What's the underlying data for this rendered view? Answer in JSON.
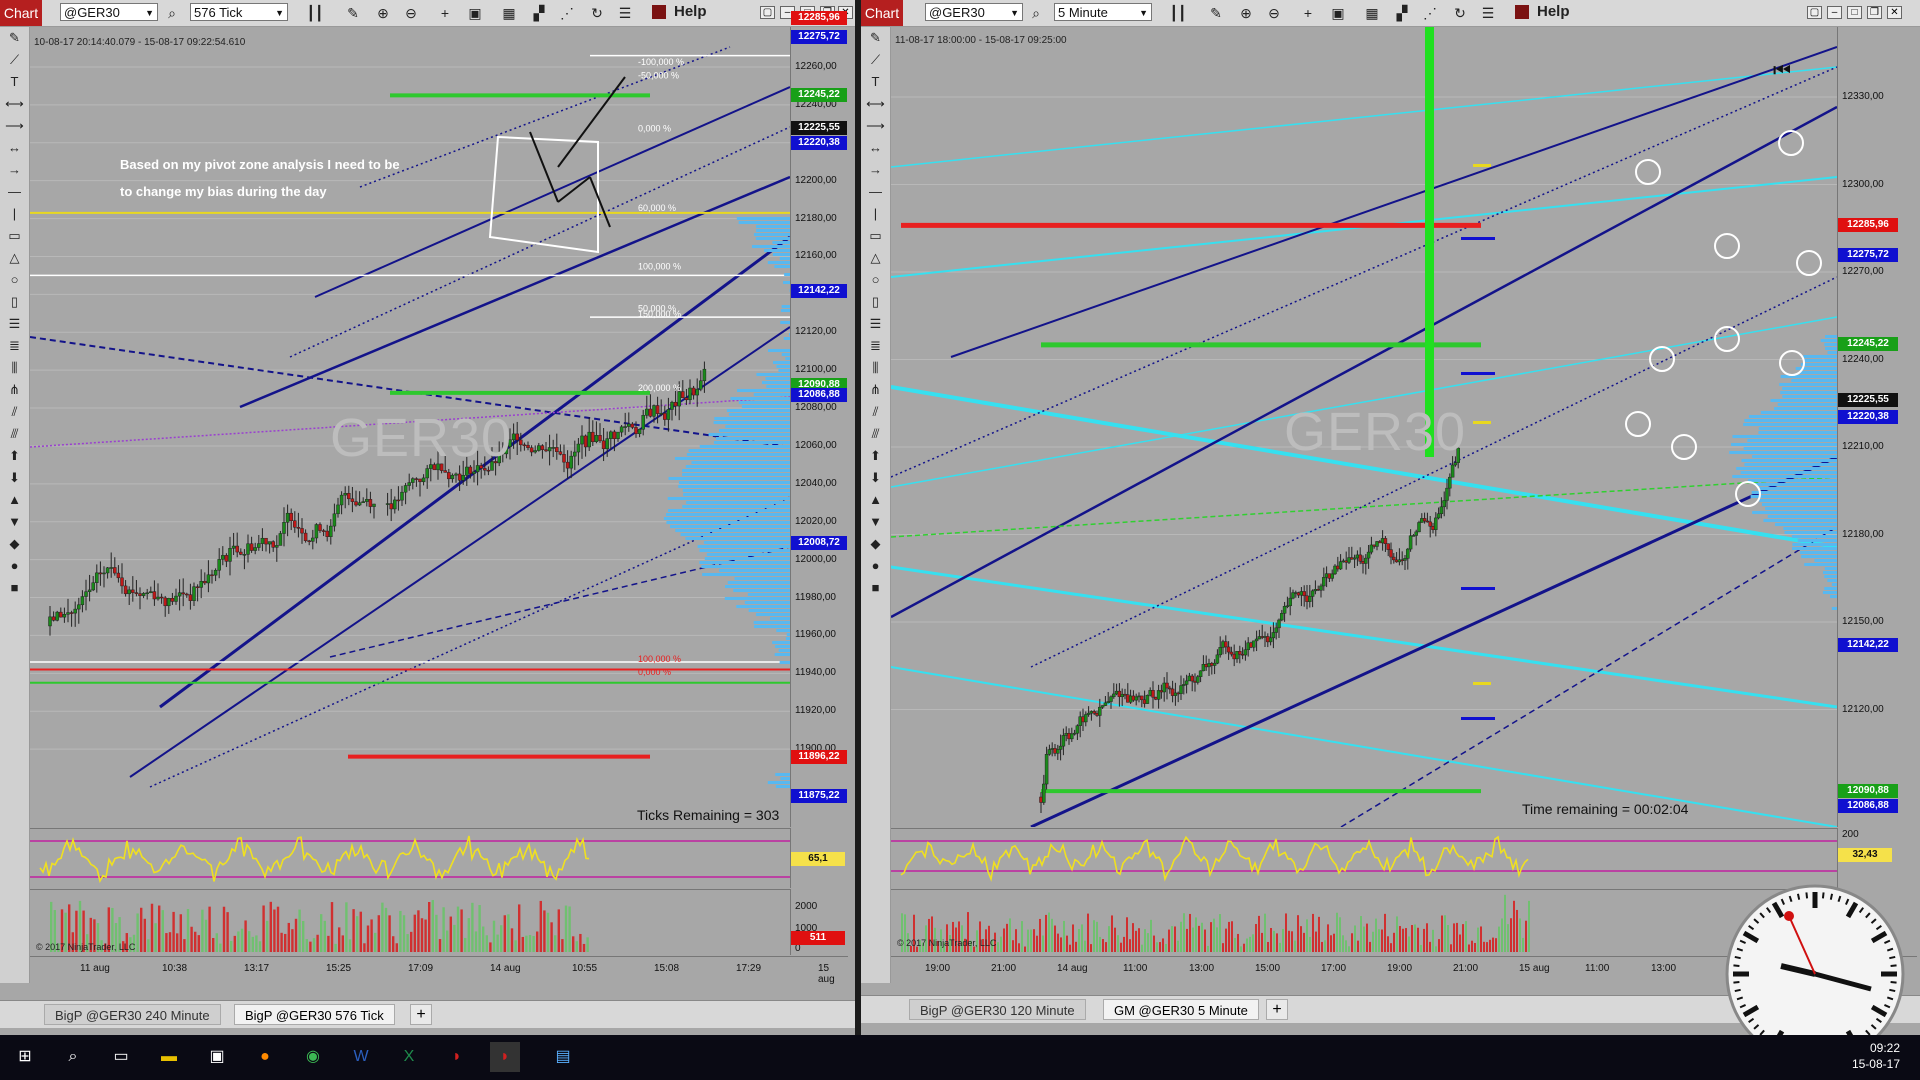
{
  "left": {
    "chart_label": "Chart",
    "instrument": "@GER30",
    "interval": "576 Tick",
    "help": "Help",
    "date_range": "10-08-17 20:14:40.079 - 15-08-17 09:22:54.610",
    "watermark": "GER30",
    "annotation_line1": "Based on my pivot zone analysis I need to be",
    "annotation_line2": "to change my bias during the day",
    "ticks_remaining": "Ticks Remaining = 303",
    "copyright": "© 2017 NinjaTrader, LLC",
    "price_ticks": [
      "12260,00",
      "12240,00",
      "12220,00",
      "12200,00",
      "12180,00",
      "12160,00",
      "12140,00",
      "12120,00",
      "12100,00",
      "12080,00",
      "12060,00",
      "12040,00",
      "12020,00",
      "12000,00",
      "11980,00",
      "11960,00",
      "11940,00",
      "11920,00",
      "11900,00"
    ],
    "price_labels": [
      {
        "text": "12285,96",
        "color": "#e01010",
        "price": 12286
      },
      {
        "text": "12275,72",
        "color": "#1010d0",
        "price": 12275.7
      },
      {
        "text": "12245,22",
        "color": "#18a018",
        "price": 12245.2
      },
      {
        "text": "12225,55",
        "color": "#111111",
        "price": 12228
      },
      {
        "text": "12220,38",
        "color": "#1010d0",
        "price": 12220
      },
      {
        "text": "12142,22",
        "color": "#1010d0",
        "price": 12142
      },
      {
        "text": "12090,88",
        "color": "#18a018",
        "price": 12092
      },
      {
        "text": "12086,88",
        "color": "#1010d0",
        "price": 12086.9
      },
      {
        "text": "12008,72",
        "color": "#1010d0",
        "price": 12008.7
      },
      {
        "text": "11896,22",
        "color": "#e01010",
        "price": 11896
      },
      {
        "text": "11875,22",
        "color": "#1010d0",
        "price": 11875.2
      }
    ],
    "fib_labels": [
      "-100,000 %",
      "-50,000 %",
      "0,000 %",
      "60,000 %",
      "100,000 %",
      "50,000 %",
      "150,000 %",
      "200,000 %",
      "100,000 %",
      "0,000 %"
    ],
    "indicator_value": "65,1",
    "volume_ticks": [
      "2000",
      "1000",
      "0"
    ],
    "volume_value": "511",
    "time_labels": [
      "11 aug",
      "10:38",
      "13:17",
      "15:25",
      "17:09",
      "14 aug",
      "10:55",
      "15:08",
      "17:29",
      "15 aug"
    ],
    "tabs": [
      "BigP @GER30 240 Minute",
      "BigP @GER30 576 Tick"
    ],
    "active_tab": 1
  },
  "right": {
    "chart_label": "Chart",
    "instrument": "@GER30",
    "interval": "5 Minute",
    "help": "Help",
    "date_range": "11-08-17 18:00:00 - 15-08-17 09:25:00",
    "watermark": "GER30",
    "time_remaining": "Time remaining = 00:02:04",
    "copyright": "© 2017 NinjaTrader, LLC",
    "price_ticks": [
      "12330,00",
      "12300,00",
      "12270,00",
      "12240,00",
      "12210,00",
      "12180,00",
      "12150,00",
      "12120,00"
    ],
    "price_labels": [
      {
        "text": "12285,96",
        "color": "#e01010",
        "price": 12286
      },
      {
        "text": "12275,72",
        "color": "#1010d0",
        "price": 12275.7
      },
      {
        "text": "12245,22",
        "color": "#18a018",
        "price": 12245.2
      },
      {
        "text": "12225,55",
        "color": "#111111",
        "price": 12226
      },
      {
        "text": "12220,38",
        "color": "#1010d0",
        "price": 12220.4
      },
      {
        "text": "12142,22",
        "color": "#1010d0",
        "price": 12142.2
      },
      {
        "text": "12090,88",
        "color": "#18a018",
        "price": 12092
      },
      {
        "text": "12086,88",
        "color": "#1010d0",
        "price": 12086.9
      }
    ],
    "indicator_top": "200",
    "indicator_value": "32,43",
    "time_labels": [
      "19:00",
      "21:00",
      "14 aug",
      "11:00",
      "13:00",
      "15:00",
      "17:00",
      "19:00",
      "21:00",
      "15 aug",
      "11:00",
      "13:00"
    ],
    "tabs": [
      "BigP @GER30 120 Minute",
      "GM @GER30 5 Minute"
    ],
    "active_tab": 1
  },
  "taskbar": {
    "time": "09:22",
    "date": "15-08-17"
  }
}
